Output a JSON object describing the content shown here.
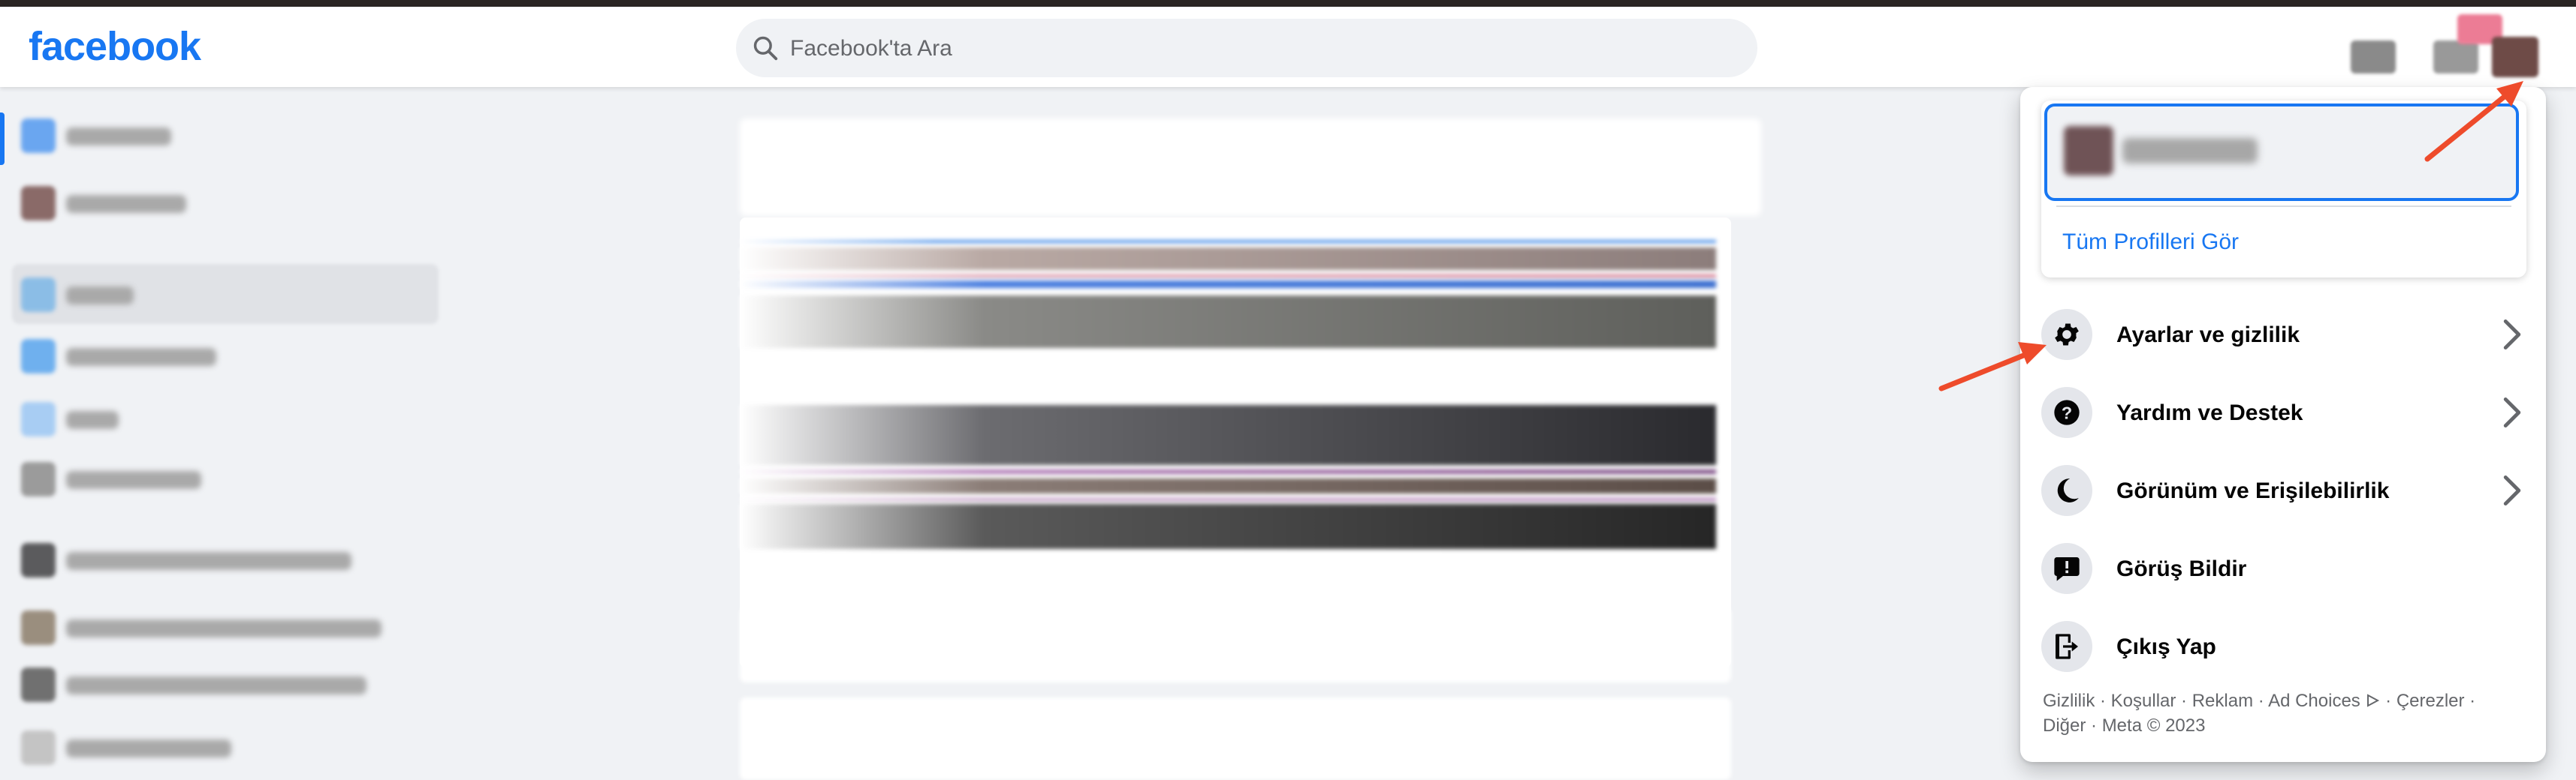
{
  "brand": {
    "logo": "facebook",
    "color": "#1877f2"
  },
  "search": {
    "placeholder": "Facebook'ta Ara",
    "value": ""
  },
  "account_menu": {
    "see_all_profiles": "Tüm Profilleri Gör",
    "items": [
      {
        "label": "Ayarlar ve gizlilik",
        "icon": "gear-icon",
        "has_chevron": true
      },
      {
        "label": "Yardım ve Destek",
        "icon": "question-icon",
        "has_chevron": true
      },
      {
        "label": "Görünüm ve Erişilebilirlik",
        "icon": "moon-icon",
        "has_chevron": true
      },
      {
        "label": "Görüş Bildir",
        "icon": "feedback-icon",
        "has_chevron": false
      },
      {
        "label": "Çıkış Yap",
        "icon": "logout-icon",
        "has_chevron": false
      }
    ],
    "footer": {
      "privacy": "Gizlilik",
      "terms": "Koşullar",
      "ads": "Reklam",
      "ad_choices": "Ad Choices",
      "cookies": "Çerezler",
      "more": "Diğer",
      "copyright": "Meta © 2023",
      "separator": " · "
    }
  },
  "annotation_color": "#ee4b2b"
}
